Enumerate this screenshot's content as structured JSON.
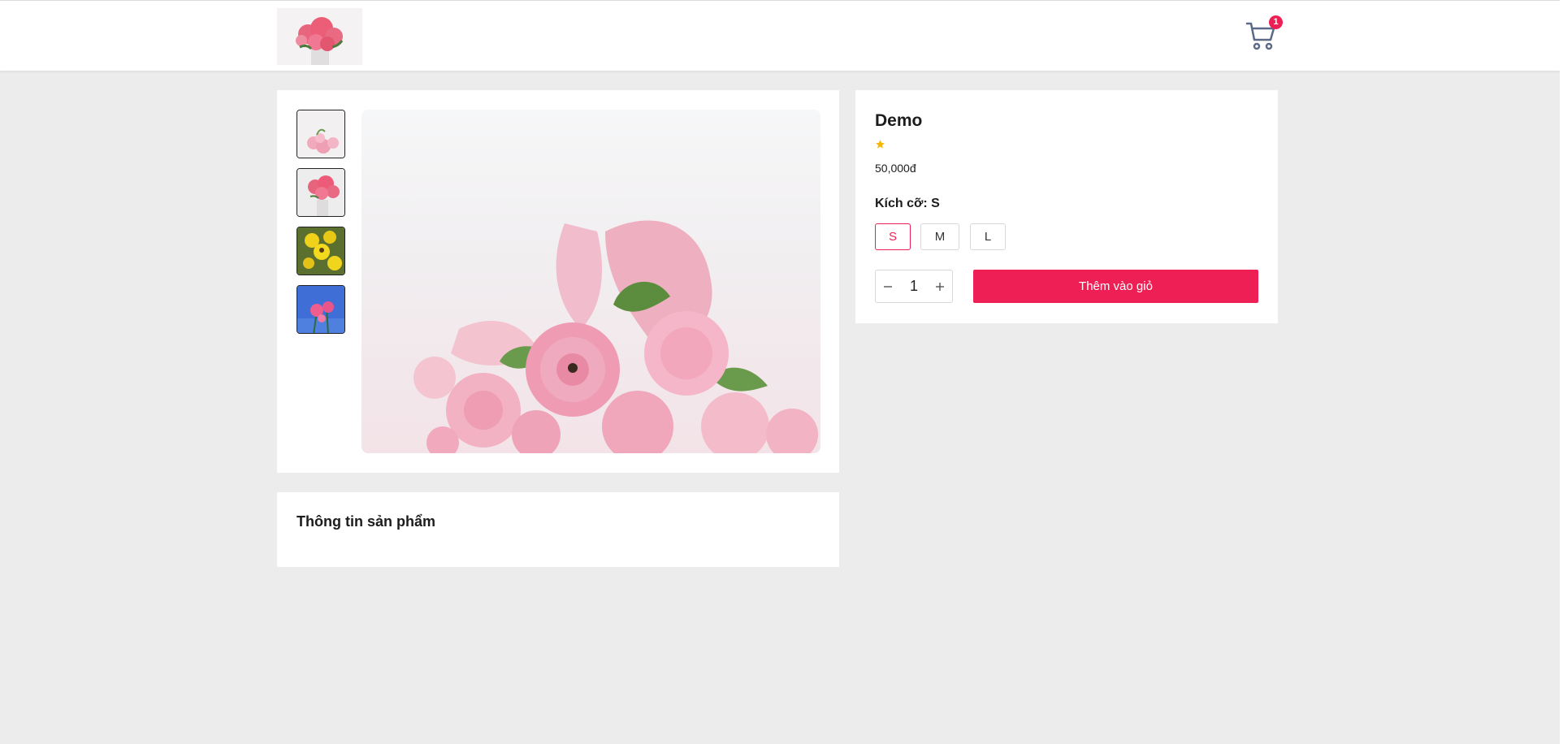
{
  "header": {
    "logo_alt": "logo",
    "cart_icon": "cart-icon",
    "cart_count": "1"
  },
  "gallery": {
    "thumbnails": [
      {
        "icon": "pink-ranunculus-image"
      },
      {
        "icon": "pink-peony-image"
      },
      {
        "icon": "yellow-flowers-image"
      },
      {
        "icon": "pink-cosmos-sky-image"
      }
    ],
    "main_image_icon": "pink-flower-bouquet-image"
  },
  "product": {
    "name": "Demo",
    "rating": 1,
    "price": "50,000đ",
    "size_label": "Kích cỡ: S",
    "sizes": [
      "S",
      "M",
      "L"
    ],
    "selected_size": "S",
    "quantity": "1",
    "minus_icon": "minus-icon",
    "plus_icon": "plus-icon",
    "add_to_cart_label": "Thêm vào giỏ"
  },
  "description": {
    "title": "Thông tin sản phẩm"
  },
  "colors": {
    "accent": "#ee1f55",
    "background": "#ebeceb",
    "star": "#f5b800"
  }
}
